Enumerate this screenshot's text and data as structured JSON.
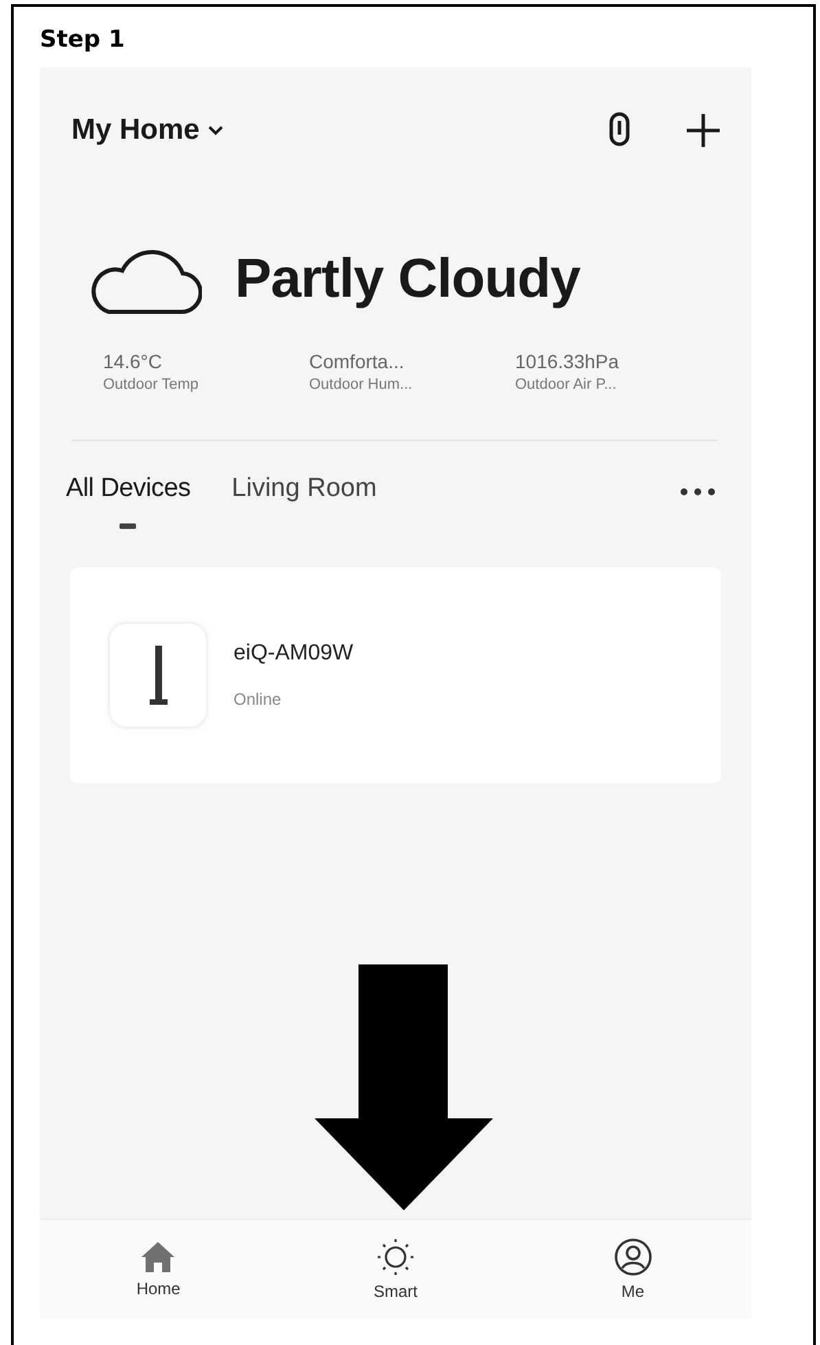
{
  "step_title": "Step 1",
  "header": {
    "home_name": "My Home"
  },
  "weather": {
    "condition": "Partly Cloudy",
    "stats": [
      {
        "value": "14.6°C",
        "label": "Outdoor Temp"
      },
      {
        "value": "Comforta...",
        "label": "Outdoor Hum..."
      },
      {
        "value": "1016.33hPa",
        "label": "Outdoor Air P..."
      }
    ]
  },
  "tabs": [
    {
      "label": "All Devices",
      "selected": true
    },
    {
      "label": "Living Room",
      "selected": false
    }
  ],
  "devices": [
    {
      "name": "eiQ-AM09W",
      "status": "Online"
    }
  ],
  "bottom_nav": [
    {
      "kind": "home",
      "label": "Home"
    },
    {
      "kind": "smart",
      "label": "Smart"
    },
    {
      "kind": "me",
      "label": "Me"
    }
  ]
}
